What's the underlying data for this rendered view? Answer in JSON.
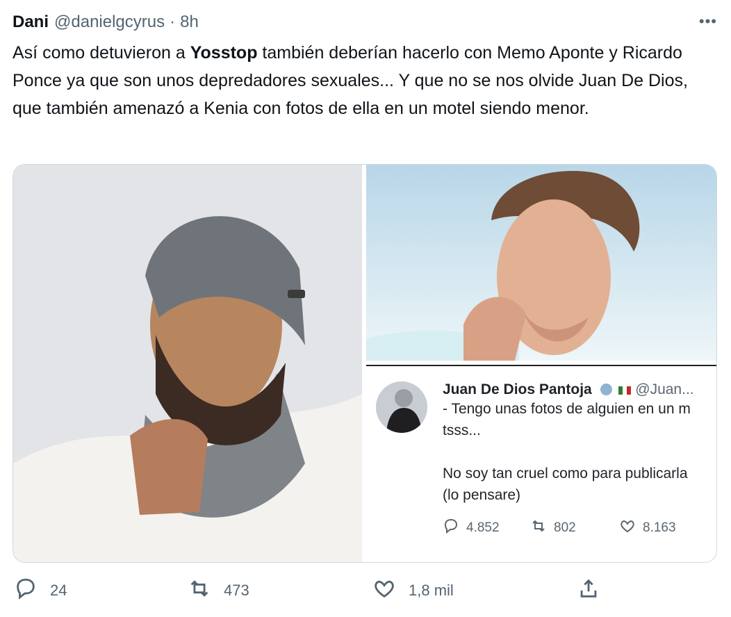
{
  "tweet": {
    "author_name": "Dani",
    "handle": "@danielgcyrus",
    "separator": "·",
    "time": "8h",
    "more_icon": "more-horizontal-icon",
    "text_before": "Así como detuvieron a ",
    "text_bold": "Yosstop",
    "text_after": " también deberían hacerlo con Memo Aponte y Ricardo Ponce ya que son unos depredadores sexuales... Y que no se nos olvide Juan De Dios, que también amenazó a Kenia con fotos de ella en un motel siendo menor."
  },
  "embedded_tweet": {
    "name": "Juan De Dios Pantoja",
    "handle": "@Juan...",
    "line1": "- Tengo unas fotos de alguien en un m",
    "line2": "tsss...",
    "line3": "No soy tan cruel como para publicarla",
    "line4": "(lo pensare)",
    "replies": "4.852",
    "retweets": "802",
    "likes": "8.163"
  },
  "actions": {
    "replies": "24",
    "retweets": "473",
    "likes": "1,8 mil"
  },
  "colors": {
    "text": "#0f1419",
    "secondary": "#536471",
    "border": "#cfd9de"
  }
}
